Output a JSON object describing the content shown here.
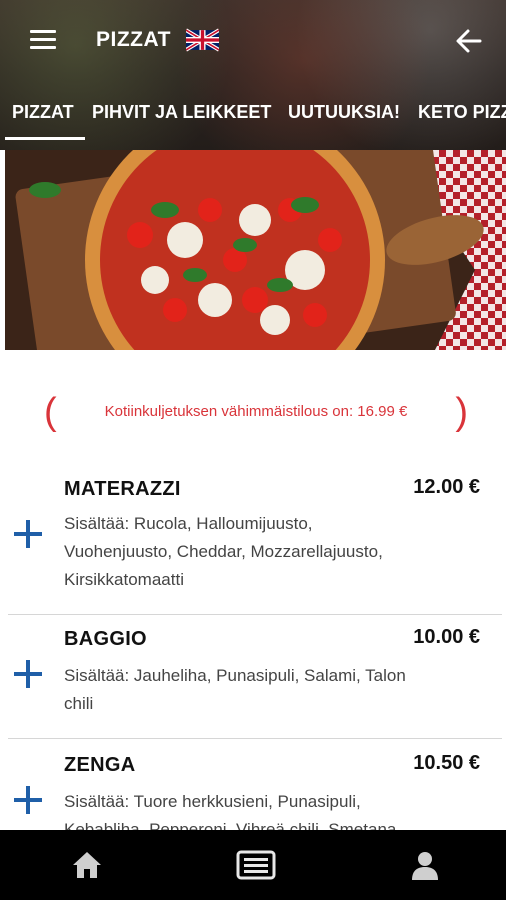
{
  "header": {
    "title": "PIZZAT",
    "menu_icon": "hamburger-menu-icon",
    "language_icon": "uk-flag-icon",
    "back_icon": "arrow-left-icon"
  },
  "tabs": [
    {
      "label": "PIZZAT",
      "active": true
    },
    {
      "label": "PIHVIT JA LEIKKEET",
      "active": false
    },
    {
      "label": "UUTUUKSIA!",
      "active": false
    },
    {
      "label": "KETO PIZZ",
      "active": false
    }
  ],
  "banner": {
    "min_order_text": "Kotiinkuljetuksen vähimmäistilous on: 16.99 €"
  },
  "menu_items": [
    {
      "name": "MATERAZZI",
      "price": "12.00 €",
      "desc_lines": [
        "Sisältää: Rucola, Halloumijuusto,",
        "Vuohenjuusto, Cheddar, Mozzarellajuusto,",
        "Kirsikkatomaatti"
      ]
    },
    {
      "name": "BAGGIO",
      "price": "10.00 €",
      "desc_lines": [
        "Sisältää: Jauheliha, Punasipuli, Salami, Talon",
        "chili"
      ]
    },
    {
      "name": "ZENGA",
      "price": "10.50 €",
      "desc_lines": [
        "Sisältää: Tuore herkkusieni, Punasipuli,",
        "Kebabliha, Pepperoni, Vihreä chili, Smetana"
      ]
    }
  ],
  "bottom_nav": {
    "items": [
      "home-icon",
      "menu-list-icon",
      "user-profile-icon"
    ]
  },
  "colors": {
    "accent_blue": "#1f5fa8",
    "notice_red": "#d9343a",
    "bottom_bar": "#000000"
  }
}
